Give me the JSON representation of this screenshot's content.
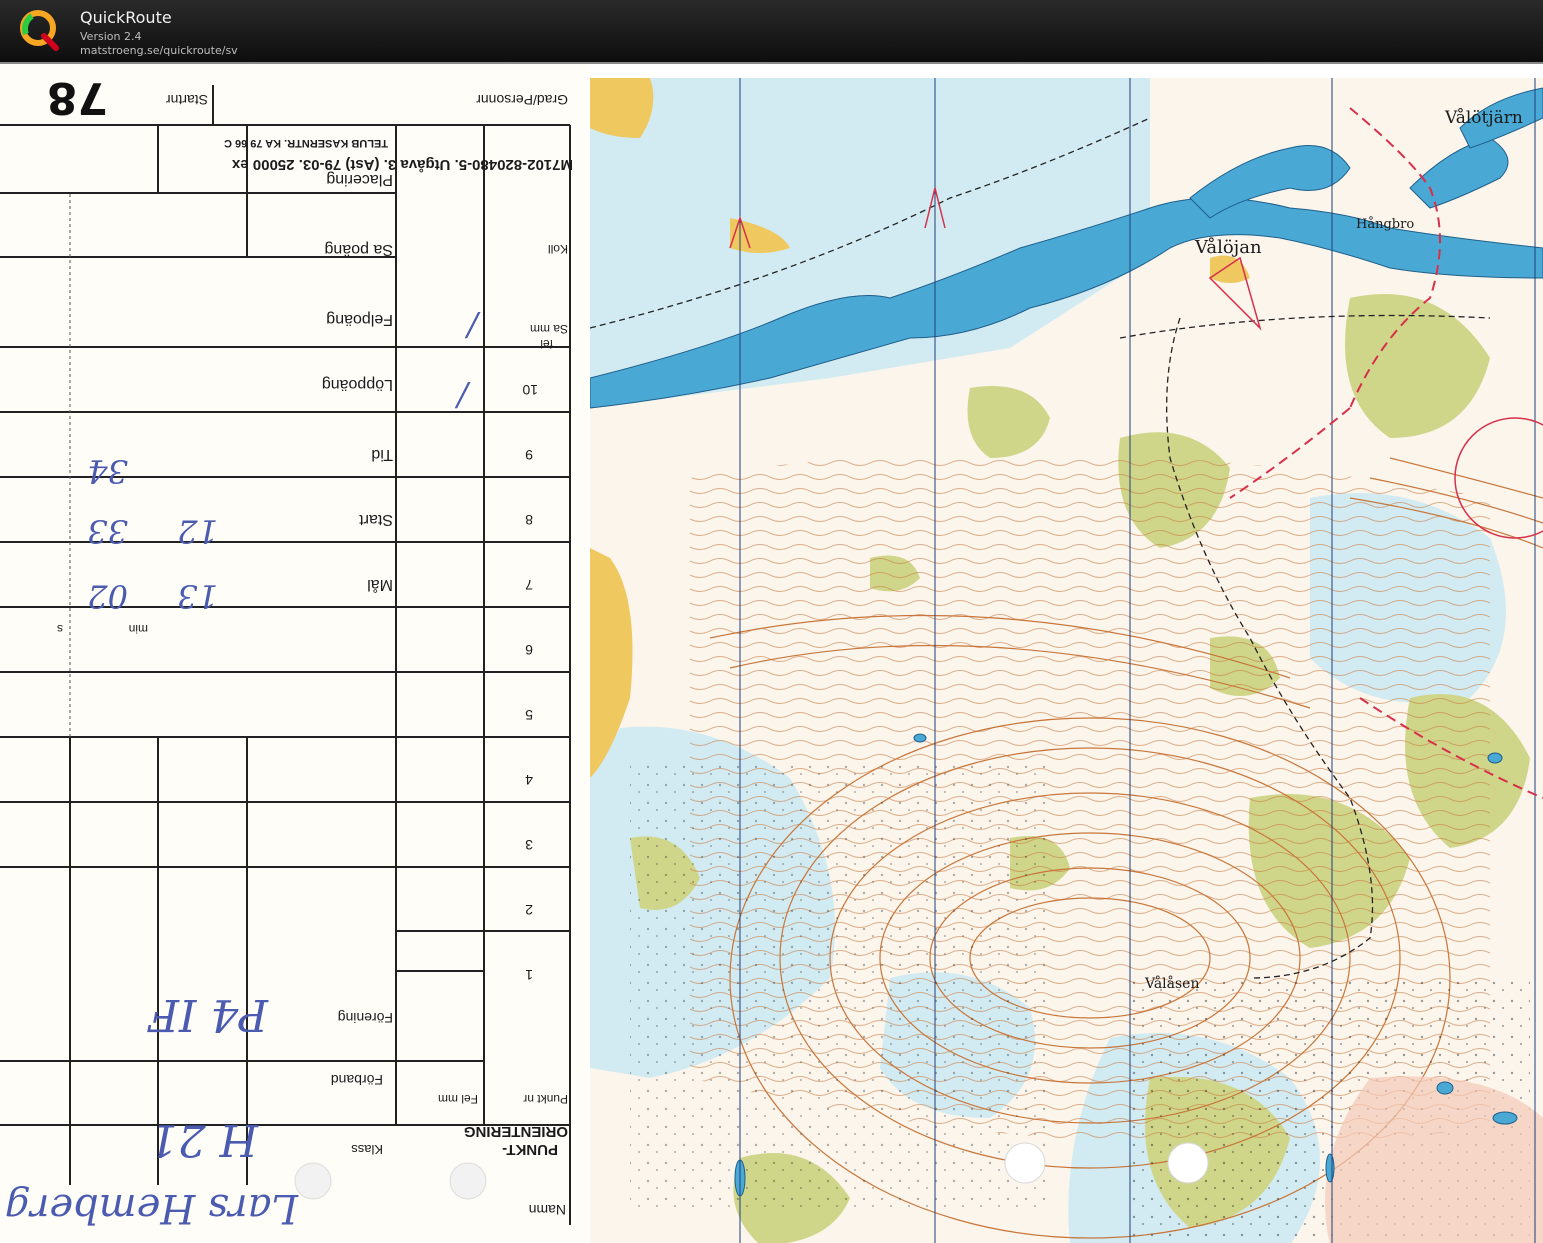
{
  "app": {
    "title": "QuickRoute",
    "version": "Version 2.4",
    "url": "matstroeng.se/quickroute/sv"
  },
  "card": {
    "print_line1": "TELUB KASERNTR. KA 79 66 C",
    "print_line2": "M7102-820480-5. Utgåva 3. (Ast) 79-03. 25000 ex",
    "header_title1": "PUNKT-",
    "header_title2": "ORIENTERING",
    "labels": {
      "placering": "Placering",
      "sa_poang": "Sa poäng",
      "koll": "Koll",
      "felpoang": "Felpoäng",
      "loppoang": "Löppoäng",
      "tid": "Tid",
      "start": "Start",
      "mal": "Mål",
      "min": "min",
      "s": "s",
      "sa_mm": "Sa mm",
      "fel": "fel",
      "forening": "Förening",
      "forband": "Förband",
      "klass": "Klass",
      "namn": "Namn",
      "grad": "Grad/Personnr",
      "startnr": "Startnr",
      "punkt_nr": "Punkt nr",
      "fel_mm": "Fel mm"
    },
    "control_numbers": [
      "10",
      "9",
      "8",
      "7",
      "6",
      "5",
      "4",
      "3",
      "2",
      "1"
    ],
    "handwritten": {
      "tid_min": "34",
      "start_h": "12",
      "start_min": "33",
      "mal_h": "13",
      "mal_min": "02",
      "forening": "P4 IF",
      "klass": "H 21",
      "namn": "Lars Hemberg",
      "startnr": "78",
      "felpoang_mark": "/",
      "loppoang_mark": "/"
    }
  },
  "map": {
    "place_names": [
      "Vålöjan",
      "Hångbro",
      "Vålåsen",
      "Vålötjärn"
    ],
    "colors": {
      "water": "#4aa8d4",
      "contour": "#c8763a",
      "green": "#cfd68a",
      "yellow": "#f0c860",
      "route": "#d6304a",
      "paper": "#fbf5ec",
      "light_blue": "#cdeaf3"
    }
  }
}
